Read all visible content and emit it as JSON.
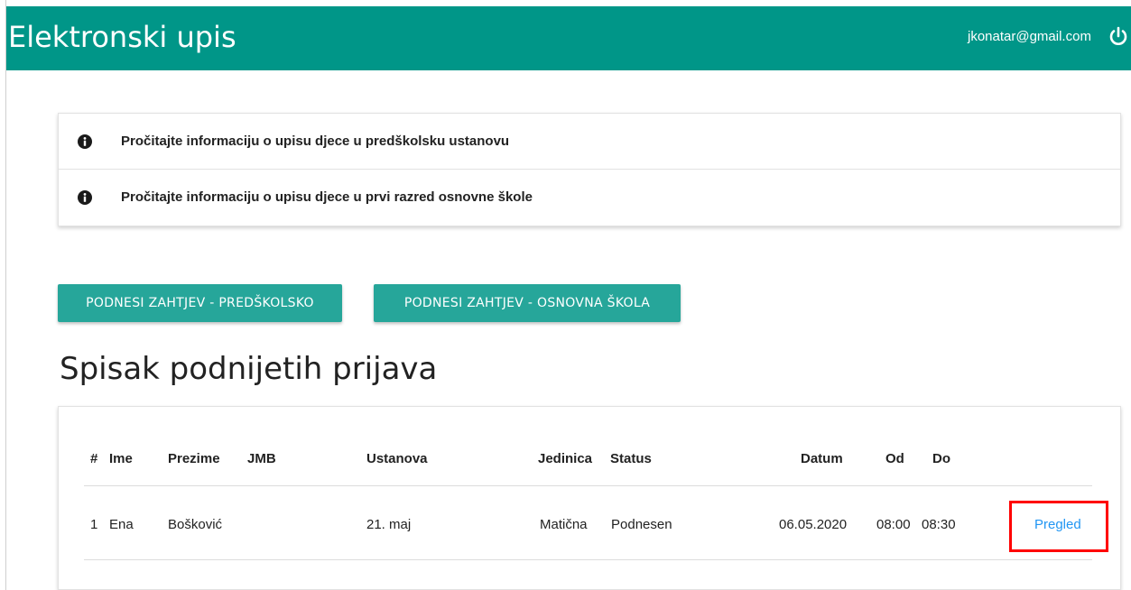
{
  "header": {
    "title": "Elektronski upis",
    "user_email": "jkonatar@gmail.com",
    "background_color": "#009688"
  },
  "info": {
    "items": [
      {
        "text": "Pročitajte informaciju o upisu djece u predškolsku ustanovu",
        "icon": "info-icon"
      },
      {
        "text": "Pročitajte informaciju o upisu djece u prvi razred osnovne škole",
        "icon": "info-icon"
      }
    ]
  },
  "actions": {
    "predskolsko_label": "PODNESI ZAHTJEV - PREDŠKOLSKO",
    "osnovna_label": "PODNESI ZAHTJEV - OSNOVNA ŠKOLA",
    "button_color": "#26a69a"
  },
  "list": {
    "title": "Spisak podnijetih prijava",
    "columns": [
      "#",
      "Ime",
      "Prezime",
      "JMB",
      "Ustanova",
      "Jedinica",
      "Status",
      "Datum",
      "Od",
      "Do"
    ],
    "rows": [
      {
        "num": "1",
        "ime": "Ena",
        "prezime": "Bošković",
        "jmb": "",
        "ustanova": "21. maj",
        "jedinica": "Matična",
        "status": "Podnesen",
        "datum": "06.05.2020",
        "od": "08:00",
        "do": "08:30",
        "action_label": "Pregled"
      }
    ],
    "link_color": "#2196f3",
    "highlight_color": "#ff0000"
  }
}
